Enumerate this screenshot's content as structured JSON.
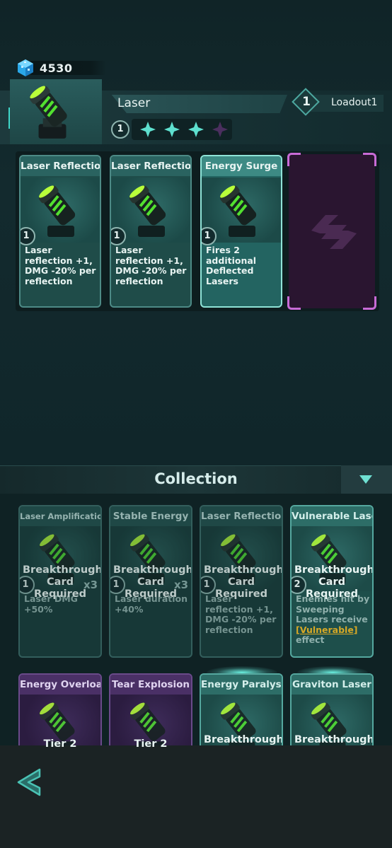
{
  "currency": {
    "icon": "cube-icon",
    "value": "4530"
  },
  "weapon": {
    "name": "Laser",
    "level": "1",
    "stars": {
      "filled": 3,
      "total": 4,
      "filled_color": "#5ee0cf",
      "empty_color": "#4a2f5e"
    }
  },
  "loadout": {
    "number": "1",
    "label": "Loadout1"
  },
  "equipped": [
    {
      "title": "Laser Reflection",
      "level": "1",
      "desc": "Laser reflection +1, DMG -20% per reflection"
    },
    {
      "title": "Laser Reflection",
      "level": "1",
      "desc": "Laser reflection +1, DMG -20% per reflection"
    },
    {
      "title": "Energy Surge",
      "level": "1",
      "desc": "Fires 2 additional Deflected Lasers"
    }
  ],
  "empty_slot": {
    "icon": "swap-icon"
  },
  "collection": {
    "title": "Collection",
    "toggle_icon": "triangle-down-icon",
    "cards": [
      {
        "title": "Laser Amplification",
        "lock": "Breakthrough Card Required",
        "level": "1",
        "count": "x3",
        "desc": "Laser DMG +50%"
      },
      {
        "title": "Stable Energy",
        "lock": "Breakthrough Card Required",
        "level": "1",
        "count": "x3",
        "desc": "Laser duration +40%"
      },
      {
        "title": "Laser Reflection",
        "lock": "Breakthrough Card Required",
        "level": "1",
        "count": "",
        "desc": "Laser reflection +1, DMG -20% per reflection"
      },
      {
        "title": "Vulnerable Laser",
        "lock": "Breakthrough Card Required",
        "level": "2",
        "count": "",
        "desc_pre": "Enemies hit by Sweeping Lasers receive ",
        "desc_tag": "[Vulnerable]",
        "desc_post": " effect"
      },
      {
        "title": "Energy Overload",
        "lock": "Tier 2"
      },
      {
        "title": "Tear Explosion",
        "lock": "Tier 2"
      },
      {
        "title": "Energy Paralysis",
        "lock": "Breakthrough"
      },
      {
        "title": "Graviton Laser",
        "lock": "Breakthrough"
      }
    ]
  },
  "nav": {
    "back_icon": "back-arrow-icon"
  }
}
